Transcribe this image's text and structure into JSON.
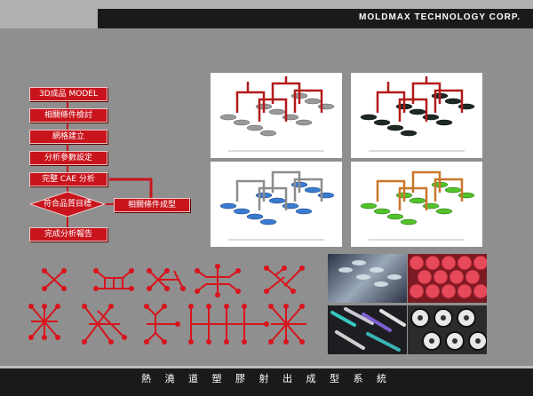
{
  "header": {
    "company": "MOLDMAX TECHNOLOGY CORP."
  },
  "footer": {
    "title": "熱 澆 道 塑 膠 射 出 成 型 系 統"
  },
  "flow": {
    "steps": [
      "3D成品 MODEL",
      "相關條件檢討",
      "網格建立",
      "分析參數設定",
      "完整 CAE 分析",
      "符合品質目標",
      "完成分析報告"
    ],
    "side": "相關條件成型"
  },
  "colors": {
    "accent": "#c8141c",
    "background": "#8f8f8f",
    "bar": "#1a1a1a"
  }
}
